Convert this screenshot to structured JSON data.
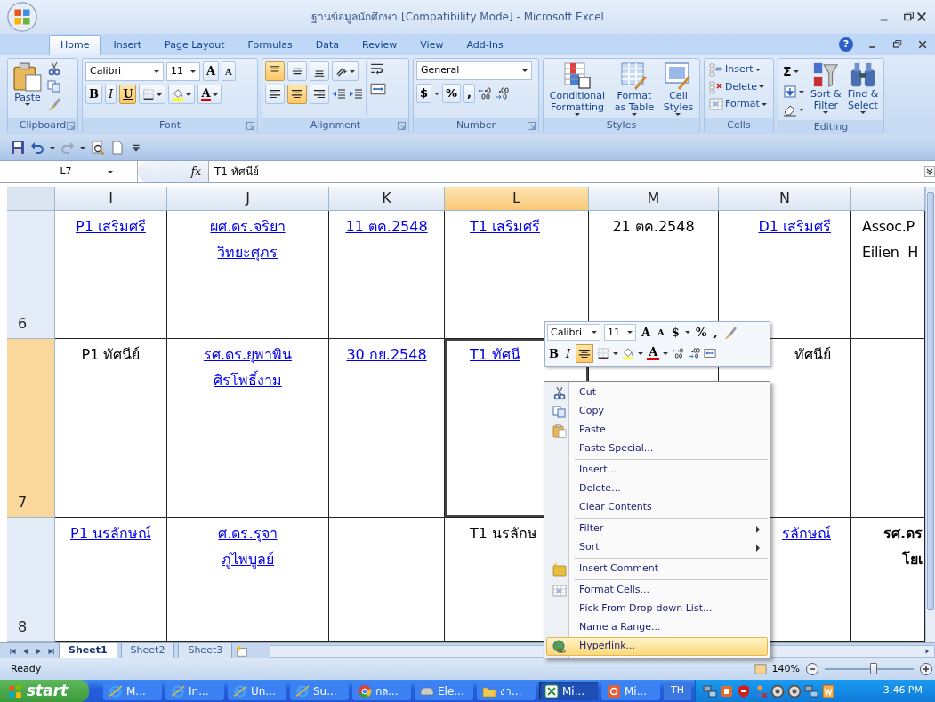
{
  "window": {
    "title": "ฐานข้อมูลนักศึกษา  [Compatibility Mode] - Microsoft Excel"
  },
  "tabs": [
    {
      "label": "Home",
      "selected": true
    },
    {
      "label": "Insert",
      "selected": false
    },
    {
      "label": "Page Layout",
      "selected": false
    },
    {
      "label": "Formulas",
      "selected": false
    },
    {
      "label": "Data",
      "selected": false
    },
    {
      "label": "Review",
      "selected": false
    },
    {
      "label": "View",
      "selected": false
    },
    {
      "label": "Add-Ins",
      "selected": false
    }
  ],
  "help": "?",
  "ribbon": {
    "clipboard": {
      "label": "Clipboard",
      "paste": "Paste"
    },
    "font": {
      "label": "Font",
      "name": "Calibri",
      "size": "11",
      "grow": "A",
      "shrink": "A",
      "font_color": "A",
      "styles": [
        {
          "text": "B",
          "active": false
        },
        {
          "text": "I",
          "active": false
        },
        {
          "text": "U",
          "active": true
        }
      ]
    },
    "alignment": {
      "label": "Alignment",
      "vertical": [
        {
          "selected": true
        },
        {
          "selected": false
        },
        {
          "selected": false
        }
      ],
      "horizontal": [
        {
          "selected": false
        },
        {
          "selected": true
        },
        {
          "selected": false
        }
      ]
    },
    "number": {
      "label": "Number",
      "format": "General",
      "symbols": [
        "$",
        "%",
        ","
      ]
    },
    "styles": {
      "label": "Styles",
      "buttons": [
        "Conditional\nFormatting",
        "Format\nas Table",
        "Cell\nStyles"
      ]
    },
    "cells": {
      "label": "Cells",
      "buttons": [
        "Insert",
        "Delete",
        "Format"
      ]
    },
    "editing": {
      "label": "Editing",
      "sum": "Σ",
      "buttons": [
        "Sort &\nFilter",
        "Find &\nSelect"
      ]
    }
  },
  "formula_bar": {
    "name_box": "L7",
    "fx": "fx",
    "value": "T1 ทัศนีย์"
  },
  "sheet": {
    "columns": [
      {
        "label": "I",
        "selected": false
      },
      {
        "label": "J",
        "selected": false
      },
      {
        "label": "K",
        "selected": false
      },
      {
        "label": "L",
        "selected": true
      },
      {
        "label": "M",
        "selected": false
      },
      {
        "label": "N",
        "selected": false
      },
      {
        "selected": false
      }
    ],
    "rows": [
      {
        "number": "6",
        "selected": false,
        "cells": [
          {
            "text": "P1 เสริมศรี",
            "link": true
          },
          {
            "text": "ผศ.ดร.จริยา\nวิทยะศุภร",
            "link": true
          },
          {
            "text": "11 ตค.2548",
            "link": true
          },
          {
            "text": "T1 เสริมศรี",
            "link": true
          },
          {
            "text": "21 ตค.2548",
            "link": false
          },
          {
            "text": "D1 เสริมศรี",
            "link": true
          },
          {
            "text": "Assoc.P\nEilien  H",
            "link": false
          }
        ]
      },
      {
        "number": "7",
        "selected": true,
        "cells": [
          {
            "text": "P1 ทัศนีย์",
            "link": false
          },
          {
            "text": "รศ.ดร.ยุพาพิน\nศิรโพธิ์งาม",
            "link": true
          },
          {
            "text": "30 กย.2548",
            "link": true
          },
          {
            "text": "T1 ทัศนี",
            "link": true
          },
          {},
          {
            "text": "ทัศนีย์",
            "link": false
          },
          {}
        ]
      },
      {
        "number": "8",
        "selected": false,
        "cells": [
          {
            "text": "P1 นรลักษณ์",
            "link": true
          },
          {
            "text": "ศ.ดร.รุจา\nภู่ไพบูลย์",
            "link": true
          },
          {},
          {
            "text": "T1 นรลักษ",
            "link": false
          },
          {},
          {
            "text": "รลักษณ์",
            "link": true
          },
          {
            "text": "รศ.ดร\nโยเ",
            "link": false,
            "bold": true
          }
        ]
      }
    ]
  },
  "mini_toolbar": {
    "font": "Calibri",
    "size": "11",
    "grow": "A",
    "shrink": "A",
    "symbols": [
      "$",
      "%",
      ","
    ],
    "bold": "B",
    "italic": "I",
    "center_selected": true,
    "font_color": "A"
  },
  "context_menu": {
    "groups": [
      [
        {
          "label": "Cut",
          "selected": false
        },
        {
          "label": "Copy",
          "selected": false
        },
        {
          "label": "Paste",
          "selected": false
        },
        {
          "label": "Paste Special...",
          "selected": false
        }
      ],
      [
        {
          "label": "Insert...",
          "selected": false
        },
        {
          "label": "Delete...",
          "selected": false
        },
        {
          "label": "Clear Contents",
          "selected": false
        }
      ],
      [
        {
          "label": "Filter",
          "selected": false,
          "submenu": true
        },
        {
          "label": "Sort",
          "selected": false,
          "submenu": true
        }
      ],
      [
        {
          "label": "Insert Comment",
          "selected": false
        }
      ],
      [
        {
          "label": "Format Cells...",
          "selected": false
        },
        {
          "label": "Pick From Drop-down List...",
          "selected": false
        },
        {
          "label": "Name a Range...",
          "selected": false
        },
        {
          "label": "Hyperlink...",
          "selected": true
        }
      ]
    ]
  },
  "sheet_tabs": [
    {
      "label": "Sheet1",
      "selected": true
    },
    {
      "label": "Sheet2",
      "selected": false
    },
    {
      "label": "Sheet3",
      "selected": false
    }
  ],
  "status_bar": {
    "text": "Ready",
    "zoom": "140%",
    "zoom_slider": {
      "level": 0.55
    }
  },
  "taskbar": {
    "start": "start",
    "items": [
      {
        "label": "M...",
        "selected": false
      },
      {
        "label": "In...",
        "selected": false
      },
      {
        "label": "Un...",
        "selected": false
      },
      {
        "label": "Su...",
        "selected": false
      },
      {
        "label": "กล...",
        "selected": false
      },
      {
        "label": "Ele...",
        "selected": false
      },
      {
        "label": "งา...",
        "selected": false
      },
      {
        "label": "Mi...",
        "selected": true
      },
      {
        "label": "Mi...",
        "selected": false
      }
    ],
    "language": "TH",
    "clock": "3:46 PM"
  }
}
